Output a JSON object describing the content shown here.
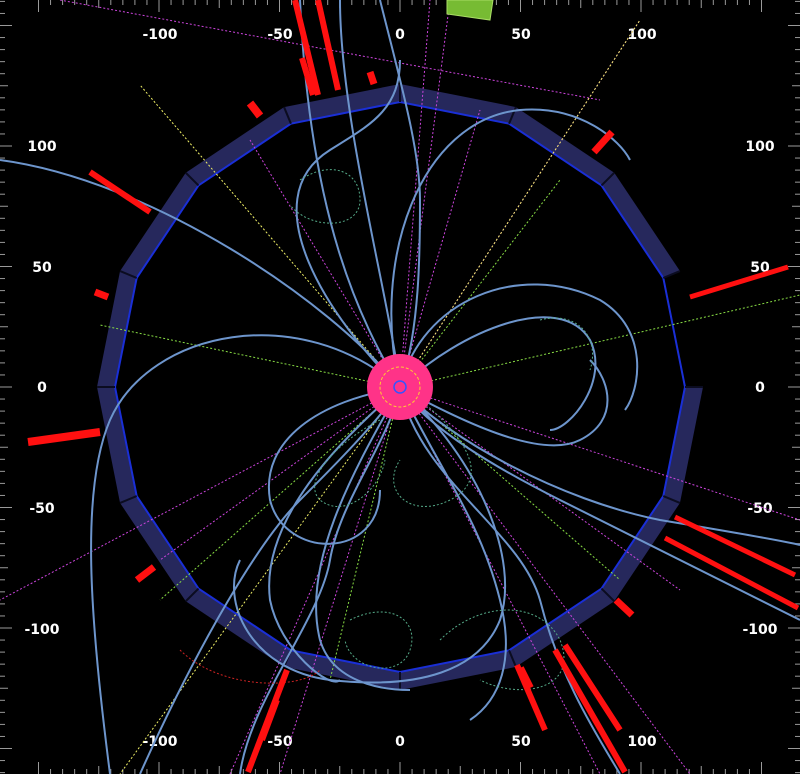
{
  "event_display": {
    "view": "transverse (x-y) projection",
    "axis_ticks": {
      "top": [
        "-100",
        "-50",
        "0",
        "50",
        "100"
      ],
      "bottom": [
        "-100",
        "-50",
        "0",
        "50",
        "100"
      ],
      "left": [
        "100",
        "50",
        "0",
        "-50",
        "-100"
      ],
      "right": [
        "100",
        "50",
        "0",
        "-50",
        "-100"
      ]
    },
    "colors": {
      "background": "#000000",
      "calorimeter_ring": "#26285c",
      "calorimeter_edge": "#1a2fd6",
      "charged_track": "#6d95cc",
      "energy_deposit": "#ff1010",
      "vertex_region": "#ff3388",
      "neutral_line_magenta": "#cc44dd",
      "neutral_line_green": "#88dd44",
      "neutral_line_yellow": "#eeee66",
      "jet_box": "#77bb33",
      "tick_text": "#ffffff"
    }
  }
}
